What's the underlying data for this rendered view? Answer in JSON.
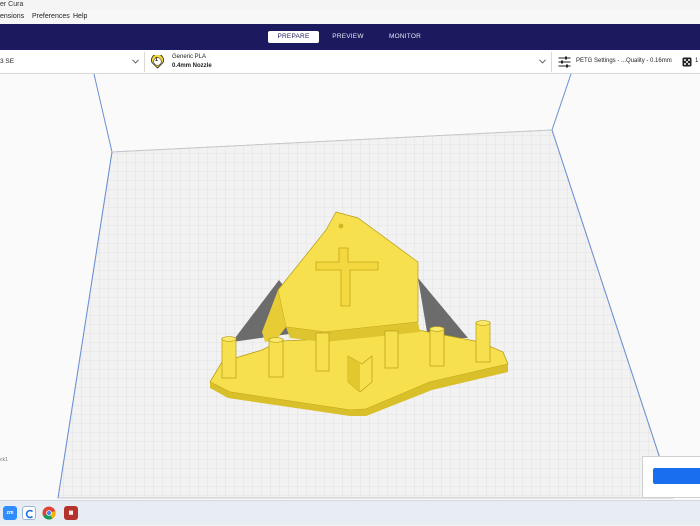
{
  "window": {
    "title": "er Cura"
  },
  "menu": {
    "items": [
      "ensions",
      "Preferences",
      "Help"
    ]
  },
  "stages": {
    "prepare": "PREPARE",
    "preview": "PREVIEW",
    "monitor": "MONITOR",
    "active": "PREPARE"
  },
  "printer": {
    "name": "3 SE"
  },
  "material": {
    "extruder_number": "1",
    "name": "Generic PLA",
    "nozzle": "0.4mm Nozzle"
  },
  "print_settings": {
    "profile": "PETG Settings - ...Quality - 0.16mm",
    "support_count": "1"
  },
  "viewport": {
    "corner_label": "ck1"
  },
  "colors": {
    "stagebar": "#1c1a5e",
    "model": "#f8e04f",
    "model_shadow": "#dcc12d",
    "accent": "#196ef0",
    "grid": "#e2e2e2"
  },
  "taskbar": {
    "apps": [
      "zoom-icon",
      "cura-icon",
      "chrome-icon",
      "extra-icon"
    ]
  }
}
